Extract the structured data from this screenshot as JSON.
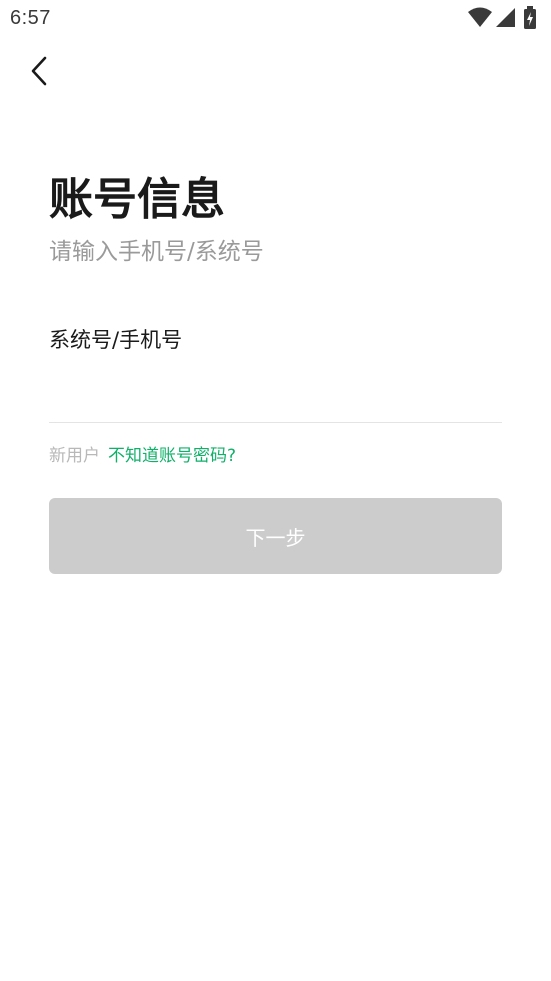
{
  "status_bar": {
    "time": "6:57",
    "icons": [
      "wifi-icon",
      "cellular-signal-icon",
      "battery-charging-icon"
    ]
  },
  "nav": {
    "back_icon": "chevron-left-icon"
  },
  "header": {
    "title": "账号信息",
    "subtitle": "请输入手机号/系统号"
  },
  "form": {
    "account_field": {
      "value": "",
      "placeholder": "系统号/手机号"
    },
    "new_user_text": "新用户",
    "forgot_link_text": "不知道账号密码?",
    "next_button_label": "下一步"
  },
  "colors": {
    "link": "#11b06a",
    "button_disabled_bg": "#cccccc",
    "subtitle": "#9a9a9a"
  }
}
